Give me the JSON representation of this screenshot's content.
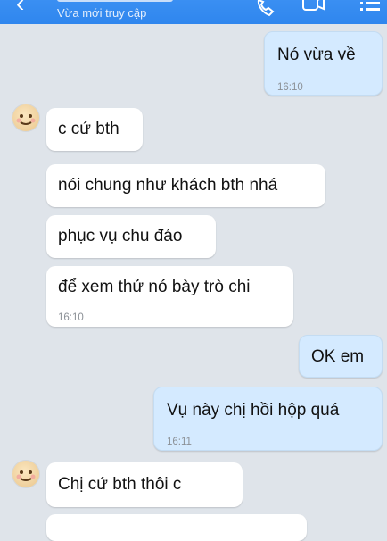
{
  "header": {
    "status": "Vừa mới truy cập",
    "back_icon": "chevron-left-icon",
    "call_icon": "phone-icon",
    "video_icon": "video-icon",
    "menu_icon": "list-menu-icon",
    "color": "#3a8ff2"
  },
  "messages": [
    {
      "side": "out",
      "text": "Nó vừa về",
      "time": "16:10"
    },
    {
      "side": "in",
      "text": "c cứ bth"
    },
    {
      "side": "in",
      "text": "nói chung như khách bth nhá"
    },
    {
      "side": "in",
      "text": "phục vụ chu đáo"
    },
    {
      "side": "in",
      "text": "để xem thử nó bày trò chi",
      "time": "16:10"
    },
    {
      "side": "out",
      "text": "OK em"
    },
    {
      "side": "out",
      "text": "Vụ này chị hồi hộp quá",
      "time": "16:11"
    },
    {
      "side": "in",
      "text": "Chị cứ bth thôi c"
    }
  ],
  "colors": {
    "background": "#dfe4ea",
    "incoming_bubble": "#ffffff",
    "outgoing_bubble": "#d4eaff"
  }
}
